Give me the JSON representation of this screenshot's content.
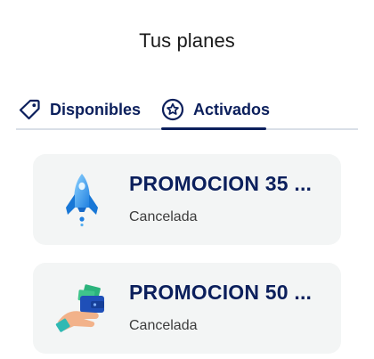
{
  "header": {
    "title": "Tus planes"
  },
  "tabs": [
    {
      "label": "Disponibles",
      "icon": "tag-icon",
      "active": false
    },
    {
      "label": "Activados",
      "icon": "star-circle-icon",
      "active": true
    }
  ],
  "plans": [
    {
      "title": "PROMOCION 35 ...",
      "status": "Cancelada",
      "icon": "rocket-icon"
    },
    {
      "title": "PROMOCION 50 ...",
      "status": "Cancelada",
      "icon": "wallet-hand-icon"
    }
  ],
  "colors": {
    "primary": "#0b1f5c",
    "card_bg": "#f3f5f5",
    "divider": "#d9dfe7"
  }
}
